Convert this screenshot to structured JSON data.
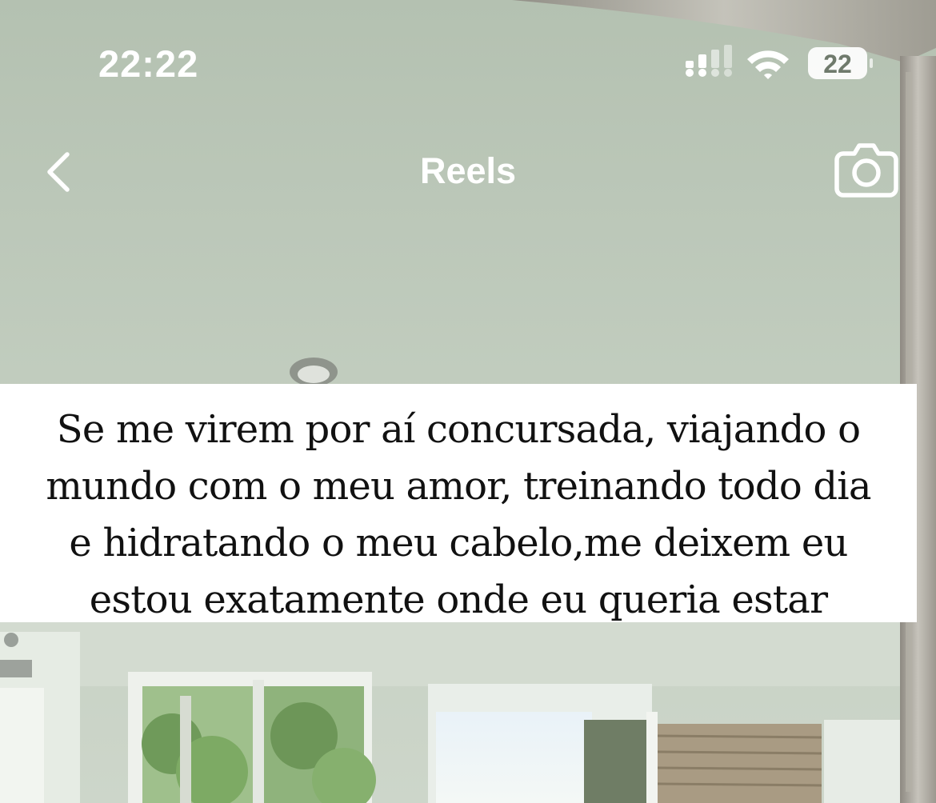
{
  "status_bar": {
    "time": "22:22",
    "battery_level": "22",
    "signal_icon": "cellular-signal-icon",
    "wifi_icon": "wifi-icon",
    "battery_icon": "battery-icon"
  },
  "header": {
    "title": "Reels",
    "back_icon": "chevron-left-icon",
    "camera_icon": "camera-icon"
  },
  "caption": {
    "lines": [
      "Se me virem por aí concursada, viajando o",
      "mundo com o meu amor, treinando todo dia",
      "e hidratando o meu cabelo,me deixem eu",
      "estou exatamente onde eu queria estar"
    ]
  },
  "colors": {
    "ui_foreground": "#ffffff",
    "caption_background": "#ffffff",
    "caption_text": "#111111"
  }
}
